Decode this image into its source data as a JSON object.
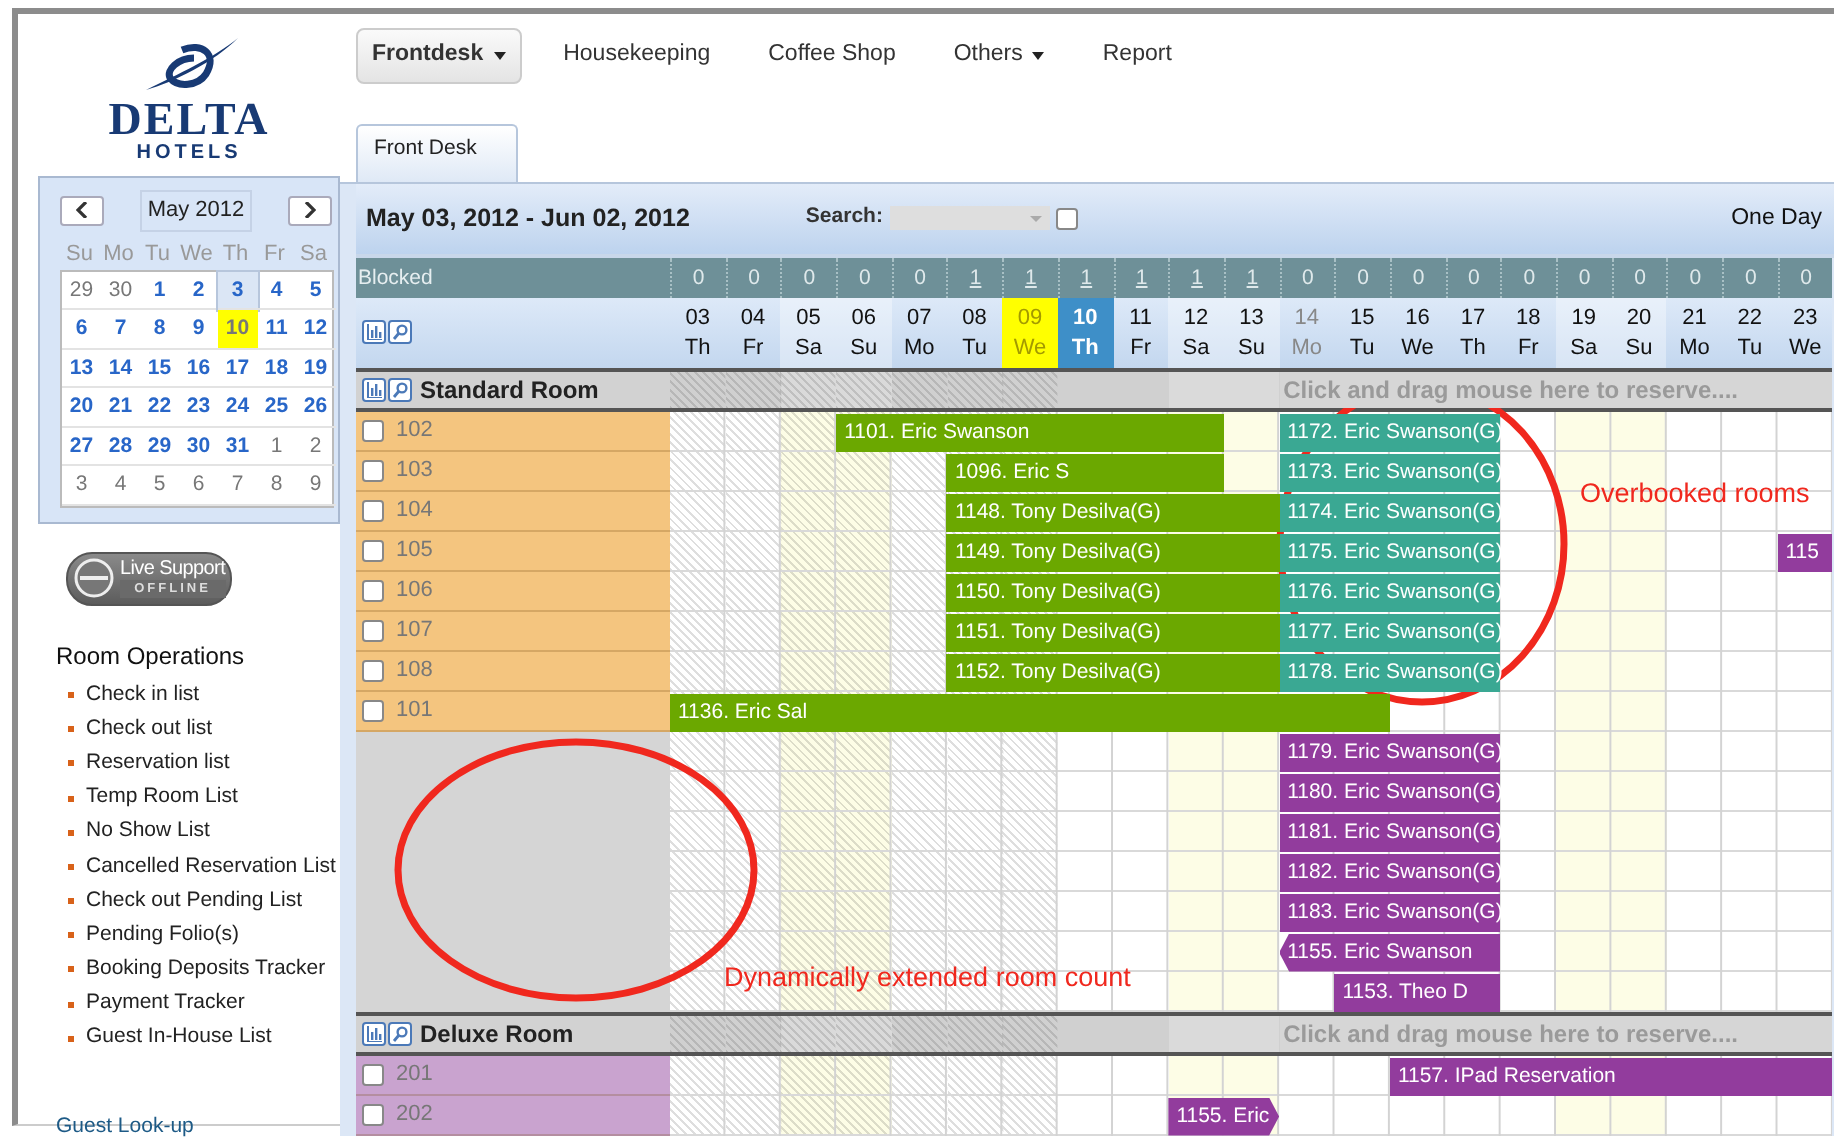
{
  "nav": [
    {
      "label": "Frontdesk",
      "selected": true,
      "dropdown": true
    },
    {
      "label": "Housekeeping",
      "selected": false,
      "dropdown": false
    },
    {
      "label": "Coffee Shop",
      "selected": false,
      "dropdown": false
    },
    {
      "label": "Others",
      "selected": false,
      "dropdown": true
    },
    {
      "label": "Report",
      "selected": false,
      "dropdown": false
    }
  ],
  "logo": {
    "name": "DELTA",
    "sub": "HOTELS"
  },
  "calendar": {
    "month": "May 2012",
    "weekdays": [
      "Su",
      "Mo",
      "Tu",
      "We",
      "Th",
      "Fr",
      "Sa"
    ],
    "weeks": [
      [
        {
          "d": "29",
          "muted": true,
          "selected": false,
          "today": false
        },
        {
          "d": "30",
          "muted": true,
          "selected": false,
          "today": false
        },
        {
          "d": "1",
          "muted": false,
          "selected": false,
          "today": false
        },
        {
          "d": "2",
          "muted": false,
          "selected": false,
          "today": false
        },
        {
          "d": "3",
          "muted": false,
          "selected": true,
          "today": false
        },
        {
          "d": "4",
          "muted": false,
          "selected": false,
          "today": false
        },
        {
          "d": "5",
          "muted": false,
          "selected": false,
          "today": false
        }
      ],
      [
        {
          "d": "6",
          "muted": false,
          "selected": false,
          "today": false
        },
        {
          "d": "7",
          "muted": false,
          "selected": false,
          "today": false
        },
        {
          "d": "8",
          "muted": false,
          "selected": false,
          "today": false
        },
        {
          "d": "9",
          "muted": false,
          "selected": false,
          "today": false
        },
        {
          "d": "10",
          "muted": false,
          "selected": false,
          "today": true
        },
        {
          "d": "11",
          "muted": false,
          "selected": false,
          "today": false
        },
        {
          "d": "12",
          "muted": false,
          "selected": false,
          "today": false
        }
      ],
      [
        {
          "d": "13",
          "muted": false,
          "selected": false,
          "today": false
        },
        {
          "d": "14",
          "muted": false,
          "selected": false,
          "today": false
        },
        {
          "d": "15",
          "muted": false,
          "selected": false,
          "today": false
        },
        {
          "d": "16",
          "muted": false,
          "selected": false,
          "today": false
        },
        {
          "d": "17",
          "muted": false,
          "selected": false,
          "today": false
        },
        {
          "d": "18",
          "muted": false,
          "selected": false,
          "today": false
        },
        {
          "d": "19",
          "muted": false,
          "selected": false,
          "today": false
        }
      ],
      [
        {
          "d": "20",
          "muted": false,
          "selected": false,
          "today": false
        },
        {
          "d": "21",
          "muted": false,
          "selected": false,
          "today": false
        },
        {
          "d": "22",
          "muted": false,
          "selected": false,
          "today": false
        },
        {
          "d": "23",
          "muted": false,
          "selected": false,
          "today": false
        },
        {
          "d": "24",
          "muted": false,
          "selected": false,
          "today": false
        },
        {
          "d": "25",
          "muted": false,
          "selected": false,
          "today": false
        },
        {
          "d": "26",
          "muted": false,
          "selected": false,
          "today": false
        }
      ],
      [
        {
          "d": "27",
          "muted": false,
          "selected": false,
          "today": false
        },
        {
          "d": "28",
          "muted": false,
          "selected": false,
          "today": false
        },
        {
          "d": "29",
          "muted": false,
          "selected": false,
          "today": false
        },
        {
          "d": "30",
          "muted": false,
          "selected": false,
          "today": false
        },
        {
          "d": "31",
          "muted": false,
          "selected": false,
          "today": false
        },
        {
          "d": "1",
          "muted": true,
          "selected": false,
          "today": false
        },
        {
          "d": "2",
          "muted": true,
          "selected": false,
          "today": false
        }
      ],
      [
        {
          "d": "3",
          "muted": true,
          "selected": false,
          "today": false
        },
        {
          "d": "4",
          "muted": true,
          "selected": false,
          "today": false
        },
        {
          "d": "5",
          "muted": true,
          "selected": false,
          "today": false
        },
        {
          "d": "6",
          "muted": true,
          "selected": false,
          "today": false
        },
        {
          "d": "7",
          "muted": true,
          "selected": false,
          "today": false
        },
        {
          "d": "8",
          "muted": true,
          "selected": false,
          "today": false
        },
        {
          "d": "9",
          "muted": true,
          "selected": false,
          "today": false
        }
      ]
    ]
  },
  "live_support": {
    "title": "Live Support",
    "status": "OFFLINE"
  },
  "operations": {
    "title": "Room Operations",
    "links": [
      "Check in list",
      "Check out list",
      "Reservation list",
      "Temp Room List",
      "No Show List",
      "Cancelled Reservation List",
      "Check out Pending List",
      "Pending Folio(s)",
      "Booking Deposits Tracker",
      "Payment Tracker",
      "Guest In-House List"
    ]
  },
  "lookup": "Guest Look-up",
  "tabs": [
    {
      "label": "Front Desk",
      "selected": true
    }
  ],
  "header": {
    "range": "May 03, 2012 - Jun 02, 2012",
    "search_label": "Search:",
    "search_checked": false,
    "view": "One Day"
  },
  "timeline": {
    "blocked_label": "Blocked",
    "days": [
      {
        "day": "03",
        "weekday": "Th",
        "blocked": "0",
        "blocked_link": false,
        "weekend": false,
        "kind": "plain"
      },
      {
        "day": "04",
        "weekday": "Fr",
        "blocked": "0",
        "blocked_link": false,
        "weekend": false,
        "kind": "plain"
      },
      {
        "day": "05",
        "weekday": "Sa",
        "blocked": "0",
        "blocked_link": false,
        "weekend": true,
        "kind": "plain"
      },
      {
        "day": "06",
        "weekday": "Su",
        "blocked": "0",
        "blocked_link": false,
        "weekend": true,
        "kind": "plain"
      },
      {
        "day": "07",
        "weekday": "Mo",
        "blocked": "0",
        "blocked_link": false,
        "weekend": false,
        "kind": "plain"
      },
      {
        "day": "08",
        "weekday": "Tu",
        "blocked": "1",
        "blocked_link": true,
        "weekend": false,
        "kind": "plain"
      },
      {
        "day": "09",
        "weekday": "We",
        "blocked": "1",
        "blocked_link": true,
        "weekend": false,
        "kind": "marked"
      },
      {
        "day": "10",
        "weekday": "Th",
        "blocked": "1",
        "blocked_link": true,
        "weekend": false,
        "kind": "today"
      },
      {
        "day": "11",
        "weekday": "Fr",
        "blocked": "1",
        "blocked_link": true,
        "weekend": false,
        "kind": "plain"
      },
      {
        "day": "12",
        "weekday": "Sa",
        "blocked": "1",
        "blocked_link": true,
        "weekend": true,
        "kind": "plain"
      },
      {
        "day": "13",
        "weekday": "Su",
        "blocked": "1",
        "blocked_link": true,
        "weekend": true,
        "kind": "plain"
      },
      {
        "day": "14",
        "weekday": "Mo",
        "blocked": "0",
        "blocked_link": false,
        "weekend": false,
        "kind": "dim"
      },
      {
        "day": "15",
        "weekday": "Tu",
        "blocked": "0",
        "blocked_link": false,
        "weekend": false,
        "kind": "plain"
      },
      {
        "day": "16",
        "weekday": "We",
        "blocked": "0",
        "blocked_link": false,
        "weekend": false,
        "kind": "plain"
      },
      {
        "day": "17",
        "weekday": "Th",
        "blocked": "0",
        "blocked_link": false,
        "weekend": false,
        "kind": "plain"
      },
      {
        "day": "18",
        "weekday": "Fr",
        "blocked": "0",
        "blocked_link": false,
        "weekend": false,
        "kind": "plain"
      },
      {
        "day": "19",
        "weekday": "Sa",
        "blocked": "0",
        "blocked_link": false,
        "weekend": true,
        "kind": "plain"
      },
      {
        "day": "20",
        "weekday": "Su",
        "blocked": "0",
        "blocked_link": false,
        "weekend": true,
        "kind": "plain"
      },
      {
        "day": "21",
        "weekday": "Mo",
        "blocked": "0",
        "blocked_link": false,
        "weekend": false,
        "kind": "plain"
      },
      {
        "day": "22",
        "weekday": "Tu",
        "blocked": "0",
        "blocked_link": false,
        "weekend": false,
        "kind": "plain"
      },
      {
        "day": "23",
        "weekday": "We",
        "blocked": "0",
        "blocked_link": false,
        "weekend": false,
        "kind": "plain"
      }
    ],
    "groups": [
      {
        "name": "Standard Room",
        "hint": "Click and drag mouse here to reserve....",
        "color": "#f4c57f",
        "rows": [
          {
            "kind": "room",
            "room": "102",
            "checked": false,
            "bookings": [
              {
                "label": "1101. Eric Swanson",
                "color": "#6ba800",
                "kind": "plain"
              },
              {
                "label": "1172. Eric Swanson(G)",
                "color": "#3aa893",
                "kind": "plain"
              }
            ]
          },
          {
            "kind": "room",
            "room": "103",
            "checked": false,
            "bookings": [
              {
                "label": "1096. Eric S",
                "color": "#6ba800",
                "kind": "plain"
              },
              {
                "label": "1173. Eric Swanson(G)",
                "color": "#3aa893",
                "kind": "plain"
              }
            ]
          },
          {
            "kind": "room",
            "room": "104",
            "checked": false,
            "bookings": [
              {
                "label": "1148. Tony Desilva(G)",
                "color": "#6ba800",
                "kind": "plain"
              },
              {
                "label": "1174. Eric Swanson(G)",
                "color": "#3aa893",
                "kind": "plain"
              }
            ]
          },
          {
            "kind": "room",
            "room": "105",
            "checked": false,
            "bookings": [
              {
                "label": "1149. Tony Desilva(G)",
                "color": "#6ba800",
                "kind": "plain"
              },
              {
                "label": "1175. Eric Swanson(G)",
                "color": "#3aa893",
                "kind": "plain"
              },
              {
                "label": "115",
                "color": "#923c9d",
                "kind": "plain"
              }
            ]
          },
          {
            "kind": "room",
            "room": "106",
            "checked": false,
            "bookings": [
              {
                "label": "1150. Tony Desilva(G)",
                "color": "#6ba800",
                "kind": "plain"
              },
              {
                "label": "1176. Eric Swanson(G)",
                "color": "#3aa893",
                "kind": "plain"
              }
            ]
          },
          {
            "kind": "room",
            "room": "107",
            "checked": false,
            "bookings": [
              {
                "label": "1151. Tony Desilva(G)",
                "color": "#6ba800",
                "kind": "plain"
              },
              {
                "label": "1177. Eric Swanson(G)",
                "color": "#3aa893",
                "kind": "plain"
              }
            ]
          },
          {
            "kind": "room",
            "room": "108",
            "checked": false,
            "bookings": [
              {
                "label": "1152. Tony Desilva(G)",
                "color": "#6ba800",
                "kind": "plain"
              },
              {
                "label": "1178. Eric Swanson(G)",
                "color": "#3aa893",
                "kind": "plain"
              }
            ]
          },
          {
            "kind": "room",
            "room": "101",
            "checked": false,
            "bookings": [
              {
                "label": "1136. Eric Sal",
                "color": "#6ba800",
                "kind": "plain"
              }
            ]
          },
          {
            "kind": "extra",
            "bookings": [
              {
                "label": "1179. Eric Swanson(G)",
                "color": "#923c9d",
                "kind": "plain"
              }
            ]
          },
          {
            "kind": "extra",
            "bookings": [
              {
                "label": "1180. Eric Swanson(G)",
                "color": "#923c9d",
                "kind": "plain"
              }
            ]
          },
          {
            "kind": "extra",
            "bookings": [
              {
                "label": "1181. Eric Swanson(G)",
                "color": "#923c9d",
                "kind": "plain"
              }
            ]
          },
          {
            "kind": "extra",
            "bookings": [
              {
                "label": "1182. Eric Swanson(G)",
                "color": "#923c9d",
                "kind": "plain"
              }
            ]
          },
          {
            "kind": "extra",
            "bookings": [
              {
                "label": "1183. Eric Swanson(G)",
                "color": "#923c9d",
                "kind": "plain"
              }
            ]
          },
          {
            "kind": "extra",
            "bookings": [
              {
                "label": "1155. Eric Swanson",
                "color": "#923c9d",
                "kind": "notch-left"
              }
            ]
          },
          {
            "kind": "extra",
            "bookings": [
              {
                "label": "1153. Theo D",
                "color": "#923c9d",
                "kind": "plain"
              }
            ]
          }
        ]
      },
      {
        "name": "Deluxe Room",
        "hint": "Click and drag mouse here to reserve....",
        "color": "#c9a3cf",
        "rows": [
          {
            "kind": "room",
            "room": "201",
            "checked": false,
            "bookings": [
              {
                "label": "1157. IPad Reservation",
                "color": "#923c9d",
                "kind": "plain"
              }
            ]
          },
          {
            "kind": "room",
            "room": "202",
            "checked": false,
            "bookings": [
              {
                "label": "1155. Eric",
                "color": "#923c9d",
                "kind": "notch-right"
              }
            ]
          }
        ]
      }
    ]
  },
  "annotations": [
    {
      "text": "Overbooked rooms"
    },
    {
      "text": "Dynamically extended room count"
    }
  ]
}
